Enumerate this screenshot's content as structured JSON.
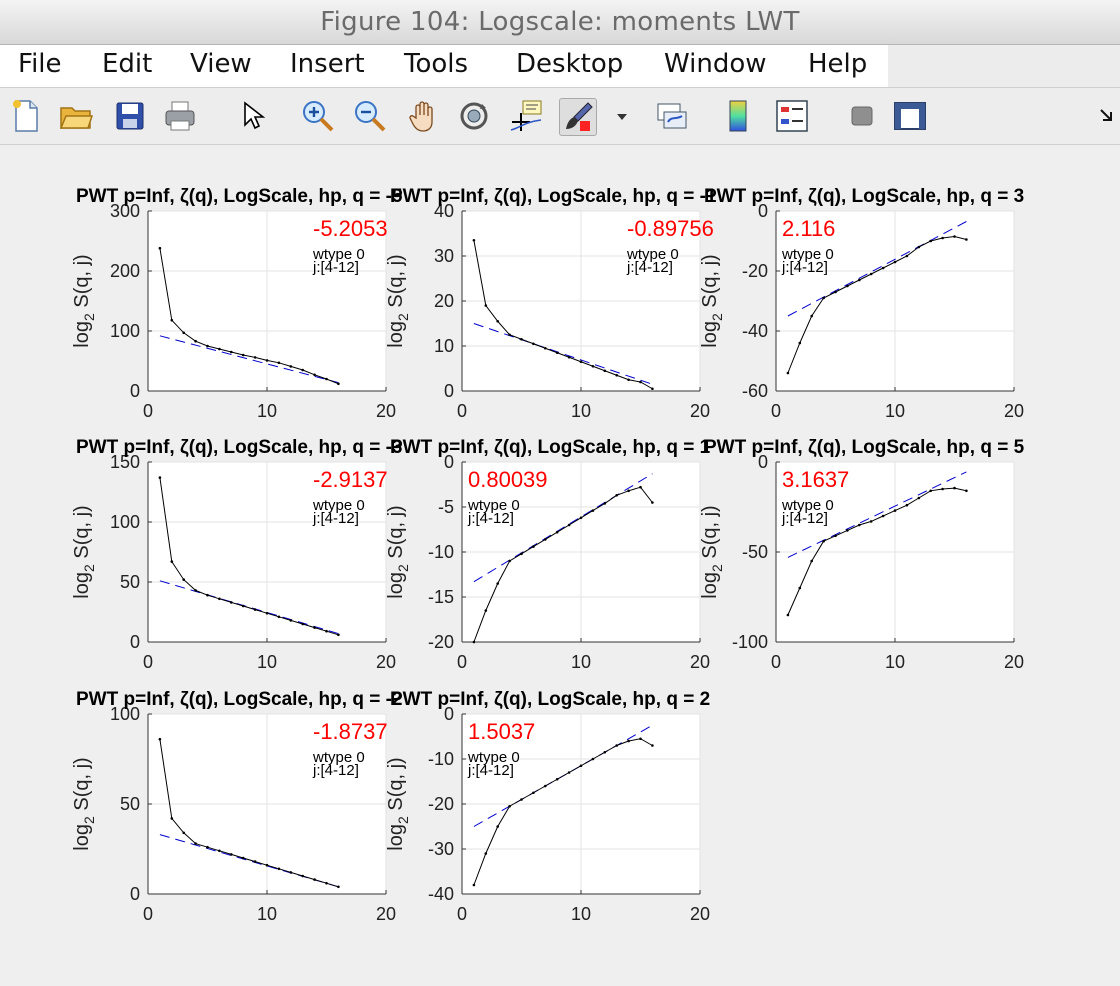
{
  "window": {
    "title": "Figure 104: Logscale: moments LWT"
  },
  "menu": [
    "File",
    "Edit",
    "View",
    "Insert",
    "Tools",
    "Desktop",
    "Window",
    "Help"
  ],
  "toolbar": [
    {
      "name": "new-figure-icon"
    },
    {
      "name": "open-file-icon"
    },
    {
      "name": "save-icon"
    },
    {
      "name": "print-icon"
    },
    {
      "name": "pointer-icon"
    },
    {
      "name": "zoom-in-icon"
    },
    {
      "name": "zoom-out-icon"
    },
    {
      "name": "pan-hand-icon"
    },
    {
      "name": "rotate-3d-icon"
    },
    {
      "name": "data-cursor-icon"
    },
    {
      "name": "brush-icon"
    },
    {
      "name": "dropdown-arrow-icon"
    },
    {
      "name": "link-plot-icon"
    },
    {
      "name": "colorbar-icon"
    },
    {
      "name": "legend-icon"
    },
    {
      "name": "hide-plot-tools-icon"
    },
    {
      "name": "show-plot-tools-icon"
    },
    {
      "name": "dock-arrow-icon"
    }
  ],
  "colors": {
    "data_line": "#000000",
    "fit_line": "#0000cc",
    "slope_text": "#ff0000"
  },
  "chart_data": [
    {
      "type": "line",
      "title": "PWT p=Inf, ζ(q), LogScale, hp, q = -5",
      "ylabel": "log2 S(q, j)",
      "xlim": [
        0,
        20
      ],
      "ylim": [
        0,
        300
      ],
      "xticks": [
        0,
        10,
        20
      ],
      "yticks": [
        0,
        100,
        200,
        300
      ],
      "slope": "-5.2053",
      "wtype": "wtype 0",
      "range": "j:[4-12]",
      "x": [
        1,
        2,
        3,
        4,
        5,
        6,
        7,
        8,
        9,
        10,
        11,
        12,
        13,
        14,
        15,
        16
      ],
      "y": [
        238,
        118,
        97,
        83,
        75,
        70,
        65,
        60,
        56,
        51,
        47,
        41,
        35,
        27,
        20,
        12
      ],
      "fit": {
        "x": [
          1,
          16
        ],
        "y": [
          92,
          14
        ]
      }
    },
    {
      "type": "line",
      "title": "PWT p=Inf, ζ(q), LogScale, hp, q = -1",
      "ylabel": "log2 S(q, j)",
      "xlim": [
        0,
        20
      ],
      "ylim": [
        0,
        40
      ],
      "xticks": [
        0,
        10,
        20
      ],
      "yticks": [
        0,
        10,
        20,
        30,
        40
      ],
      "slope": "-0.89756",
      "wtype": "wtype 0",
      "range": "j:[4-12]",
      "x": [
        1,
        2,
        3,
        4,
        5,
        6,
        7,
        8,
        9,
        10,
        11,
        12,
        13,
        14,
        15,
        16
      ],
      "y": [
        33.5,
        19,
        15.5,
        12.5,
        11.5,
        10.5,
        9.5,
        8.5,
        7.5,
        6.5,
        5.5,
        4.5,
        3.5,
        2.5,
        2,
        0.5
      ],
      "fit": {
        "x": [
          1,
          16
        ],
        "y": [
          15,
          1.5
        ]
      }
    },
    {
      "type": "line",
      "title": "PWT p=Inf, ζ(q), LogScale, hp, q = 3",
      "ylabel": "log2 S(q, j)",
      "xlim": [
        0,
        20
      ],
      "ylim": [
        -60,
        0
      ],
      "xticks": [
        0,
        10,
        20
      ],
      "yticks": [
        -60,
        -40,
        -20,
        0
      ],
      "slope": "2.116",
      "wtype": "wtype 0",
      "range": "j:[4-12]",
      "x": [
        1,
        2,
        3,
        4,
        5,
        6,
        7,
        8,
        9,
        10,
        11,
        12,
        13,
        14,
        15,
        16
      ],
      "y": [
        -54,
        -44,
        -35,
        -29,
        -27,
        -25,
        -23,
        -21,
        -19,
        -17,
        -15,
        -12,
        -10,
        -9,
        -8.5,
        -9.5
      ],
      "fit": {
        "x": [
          1,
          16
        ],
        "y": [
          -35,
          -3.5
        ]
      }
    },
    {
      "type": "line",
      "title": "PWT p=Inf, ζ(q), LogScale, hp, q = -3",
      "ylabel": "log2 S(q, j)",
      "xlim": [
        0,
        20
      ],
      "ylim": [
        0,
        150
      ],
      "xticks": [
        0,
        10,
        20
      ],
      "yticks": [
        0,
        50,
        100,
        150
      ],
      "slope": "-2.9137",
      "wtype": "wtype 0",
      "range": "j:[4-12]",
      "x": [
        1,
        2,
        3,
        4,
        5,
        6,
        7,
        8,
        9,
        10,
        11,
        12,
        13,
        14,
        15,
        16
      ],
      "y": [
        137,
        67,
        52,
        43,
        39,
        36,
        33,
        30,
        27,
        24,
        21,
        18,
        15,
        12,
        9,
        6
      ],
      "fit": {
        "x": [
          1,
          16
        ],
        "y": [
          51,
          7
        ]
      }
    },
    {
      "type": "line",
      "title": "PWT p=Inf, ζ(q), LogScale, hp, q = 1",
      "ylabel": "log2 S(q, j)",
      "xlim": [
        0,
        20
      ],
      "ylim": [
        -20,
        0
      ],
      "xticks": [
        0,
        10,
        20
      ],
      "yticks": [
        -20,
        -15,
        -10,
        -5,
        0
      ],
      "slope": "0.80039",
      "wtype": "wtype 0",
      "range": "j:[4-12]",
      "x": [
        1,
        2,
        3,
        4,
        5,
        6,
        7,
        8,
        9,
        10,
        11,
        12,
        13,
        14,
        15,
        16
      ],
      "y": [
        -20,
        -16.5,
        -13.5,
        -11,
        -10.2,
        -9.4,
        -8.6,
        -7.8,
        -7,
        -6.2,
        -5.4,
        -4.6,
        -3.7,
        -3.2,
        -2.8,
        -4.5
      ],
      "fit": {
        "x": [
          1,
          16
        ],
        "y": [
          -13.3,
          -1.3
        ]
      }
    },
    {
      "type": "line",
      "title": "PWT p=Inf, ζ(q), LogScale, hp, q = 5",
      "ylabel": "log2 S(q, j)",
      "xlim": [
        0,
        20
      ],
      "ylim": [
        -100,
        0
      ],
      "xticks": [
        0,
        10,
        20
      ],
      "yticks": [
        -100,
        -50,
        0
      ],
      "slope": "3.1637",
      "wtype": "wtype 0",
      "range": "j:[4-12]",
      "x": [
        1,
        2,
        3,
        4,
        5,
        6,
        7,
        8,
        9,
        10,
        11,
        12,
        13,
        14,
        15,
        16
      ],
      "y": [
        -85,
        -70,
        -55,
        -44,
        -41,
        -38,
        -35,
        -33,
        -30,
        -27,
        -24,
        -20,
        -16,
        -15,
        -14.5,
        -16
      ],
      "fit": {
        "x": [
          1,
          16
        ],
        "y": [
          -53,
          -5.5
        ]
      }
    },
    {
      "type": "line",
      "title": "PWT p=Inf, ζ(q), LogScale, hp, q = -2",
      "ylabel": "log2 S(q, j)",
      "xlim": [
        0,
        20
      ],
      "ylim": [
        0,
        100
      ],
      "xticks": [
        0,
        10,
        20
      ],
      "yticks": [
        0,
        50,
        100
      ],
      "slope": "-1.8737",
      "wtype": "wtype 0",
      "range": "j:[4-12]",
      "x": [
        1,
        2,
        3,
        4,
        5,
        6,
        7,
        8,
        9,
        10,
        11,
        12,
        13,
        14,
        15,
        16
      ],
      "y": [
        86,
        42,
        34,
        28,
        26,
        24,
        22,
        20,
        18,
        16,
        14,
        12,
        10,
        8,
        6,
        4
      ],
      "fit": {
        "x": [
          1,
          16
        ],
        "y": [
          33,
          4
        ]
      }
    },
    {
      "type": "line",
      "title": "PWT p=Inf, ζ(q), LogScale, hp, q = 2",
      "ylabel": "log2 S(q, j)",
      "xlim": [
        0,
        20
      ],
      "ylim": [
        -40,
        0
      ],
      "xticks": [
        0,
        10,
        20
      ],
      "yticks": [
        -40,
        -30,
        -20,
        -10,
        0
      ],
      "slope": "1.5037",
      "wtype": "wtype 0",
      "range": "j:[4-12]",
      "x": [
        1,
        2,
        3,
        4,
        5,
        6,
        7,
        8,
        9,
        10,
        11,
        12,
        13,
        14,
        15,
        16
      ],
      "y": [
        -38,
        -31,
        -25,
        -20.5,
        -19,
        -17.5,
        -16,
        -14.5,
        -13,
        -11.5,
        -10,
        -8.5,
        -7,
        -6,
        -5.5,
        -7
      ],
      "fit": {
        "x": [
          1,
          16
        ],
        "y": [
          -25,
          -2.5
        ]
      }
    }
  ]
}
